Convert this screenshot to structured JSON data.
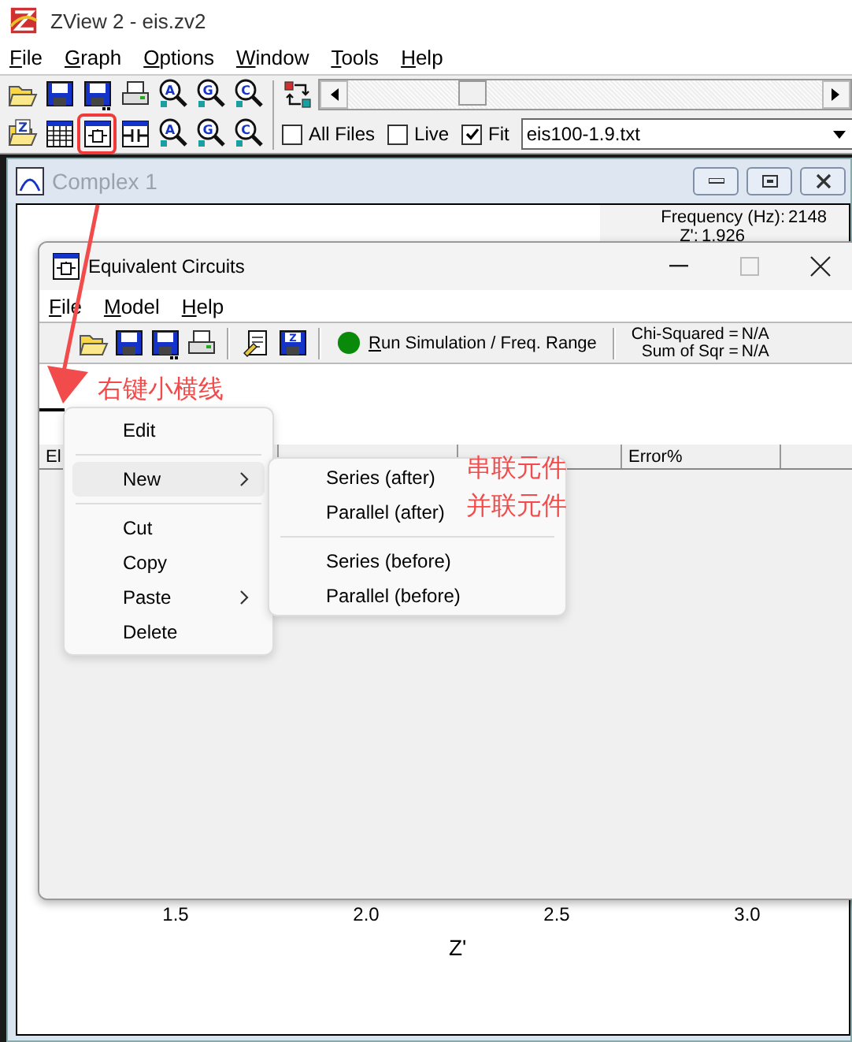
{
  "app": {
    "title": "ZView 2 - eis.zv2",
    "menu": [
      "File",
      "Graph",
      "Options",
      "Window",
      "Tools",
      "Help"
    ],
    "toolbar_rows": [
      [
        {
          "kind": "open"
        },
        {
          "kind": "save"
        },
        {
          "kind": "save-as"
        },
        {
          "kind": "print"
        },
        {
          "kind": "zoom",
          "letter": "A"
        },
        {
          "kind": "zoom",
          "letter": "G"
        },
        {
          "kind": "zoom",
          "letter": "C"
        }
      ],
      [
        {
          "kind": "open",
          "letter": "Z"
        },
        {
          "kind": "table"
        },
        {
          "kind": "circuit",
          "highlighted": true
        },
        {
          "kind": "capacitor"
        },
        {
          "kind": "zoom",
          "letter": "A"
        },
        {
          "kind": "zoom",
          "letter": "G"
        },
        {
          "kind": "zoom",
          "letter": "C"
        }
      ]
    ],
    "options": [
      {
        "label": "All Files",
        "checked": false
      },
      {
        "label": "Live",
        "checked": false
      },
      {
        "label": "Fit",
        "checked": true
      }
    ],
    "file_field": {
      "value": "eis100-1.9.txt"
    }
  },
  "complex_window": {
    "title": "Complex 1",
    "readout": [
      {
        "label": "Frequency (Hz):",
        "value": "2148"
      },
      {
        "label": "Z':",
        "value": "1.926"
      }
    ],
    "x_ticks": [
      "1.5",
      "2.0",
      "2.5",
      "3.0"
    ],
    "x_axis_label": "Z'"
  },
  "circuit_window": {
    "title": "Equivalent Circuits",
    "menu": [
      "File",
      "Model",
      "Help"
    ],
    "toolbar": [
      {
        "kind": "open"
      },
      {
        "kind": "save"
      },
      {
        "kind": "save-as"
      },
      {
        "kind": "print"
      },
      {
        "kind": "separator"
      },
      {
        "kind": "edit"
      },
      {
        "kind": "save",
        "letter": "Z"
      },
      {
        "kind": "separator"
      }
    ],
    "run_button": "Run Simulation / Freq. Range",
    "stats": [
      {
        "label": "Chi-Squared =",
        "value": "N/A"
      },
      {
        "label": "Sum of Sqr =",
        "value": "N/A"
      }
    ],
    "column_headers": [
      "El",
      "Error%"
    ]
  },
  "context_menu": {
    "items": [
      {
        "kind": "item",
        "label": "Edit",
        "selected": false,
        "submenu": false
      },
      {
        "kind": "separator"
      },
      {
        "kind": "item",
        "label": "New",
        "selected": true,
        "submenu": true
      },
      {
        "kind": "separator"
      },
      {
        "kind": "item",
        "label": "Cut",
        "selected": false,
        "submenu": false
      },
      {
        "kind": "item",
        "label": "Copy",
        "selected": false,
        "submenu": false
      },
      {
        "kind": "item",
        "label": "Paste",
        "selected": false,
        "submenu": true
      },
      {
        "kind": "item",
        "label": "Delete",
        "selected": false,
        "submenu": false
      }
    ]
  },
  "submenu": {
    "items": [
      {
        "kind": "item",
        "label": "Series (after)",
        "selected": false
      },
      {
        "kind": "item",
        "label": "Parallel (after)",
        "selected": false
      },
      {
        "kind": "separator"
      },
      {
        "kind": "item",
        "label": "Series (before)",
        "selected": false
      },
      {
        "kind": "item",
        "label": "Parallel (before)",
        "selected": false
      }
    ]
  },
  "annotations": {
    "arrow_label": "右键小横线",
    "notes": [
      "串联元件",
      "并联元件"
    ]
  }
}
